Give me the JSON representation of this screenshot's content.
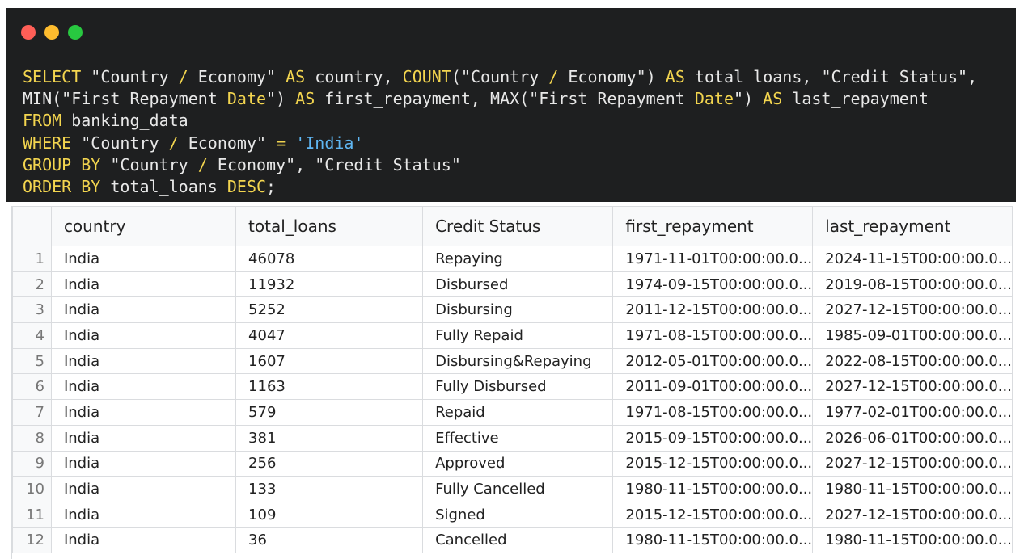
{
  "window": {
    "buttons": [
      "close",
      "minimize",
      "maximize"
    ],
    "colors": {
      "close": "#ff5f57",
      "minimize": "#febc2e",
      "maximize": "#28c840"
    }
  },
  "sql": {
    "lines": [
      [
        [
          "kw",
          "SELECT"
        ],
        [
          "t",
          " \"Country "
        ],
        [
          "op",
          "/"
        ],
        [
          "t",
          " Economy\" "
        ],
        [
          "kw",
          "AS"
        ],
        [
          "t",
          " country, "
        ],
        [
          "kw",
          "COUNT"
        ],
        [
          "t",
          "(\"Country "
        ],
        [
          "op",
          "/"
        ],
        [
          "t",
          " Economy\") "
        ],
        [
          "kw",
          "AS"
        ],
        [
          "t",
          " total_loans, \"Credit Status\","
        ]
      ],
      [
        [
          "t",
          "MIN(\"First Repayment "
        ],
        [
          "kw",
          "Date"
        ],
        [
          "t",
          "\") "
        ],
        [
          "kw",
          "AS"
        ],
        [
          "t",
          " first_repayment, MAX(\"First Repayment "
        ],
        [
          "kw",
          "Date"
        ],
        [
          "t",
          "\") "
        ],
        [
          "kw",
          "AS"
        ],
        [
          "t",
          " last_repayment"
        ]
      ],
      [
        [
          "kw",
          "FROM"
        ],
        [
          "t",
          " banking_data"
        ]
      ],
      [
        [
          "kw",
          "WHERE"
        ],
        [
          "t",
          " \"Country "
        ],
        [
          "op",
          "/"
        ],
        [
          "t",
          " Economy\" "
        ],
        [
          "op",
          "="
        ],
        [
          "t",
          " "
        ],
        [
          "str",
          "'India'"
        ]
      ],
      [
        [
          "kw",
          "GROUP BY"
        ],
        [
          "t",
          " \"Country "
        ],
        [
          "op",
          "/"
        ],
        [
          "t",
          " Economy\", \"Credit Status\""
        ]
      ],
      [
        [
          "kw",
          "ORDER BY"
        ],
        [
          "t",
          " total_loans "
        ],
        [
          "kw",
          "DESC"
        ],
        [
          "t",
          ";"
        ]
      ]
    ]
  },
  "results": {
    "columns": [
      "country",
      "total_loans",
      "Credit Status",
      "first_repayment",
      "last_repayment"
    ],
    "rows": [
      [
        "1",
        "India",
        "46078",
        "Repaying",
        "1971-11-01T00:00:00.0...",
        "2024-11-15T00:00:00.0..."
      ],
      [
        "2",
        "India",
        "11932",
        "Disbursed",
        "1974-09-15T00:00:00.0...",
        "2019-08-15T00:00:00.0..."
      ],
      [
        "3",
        "India",
        "5252",
        "Disbursing",
        "2011-12-15T00:00:00.0...",
        "2027-12-15T00:00:00.0..."
      ],
      [
        "4",
        "India",
        "4047",
        "Fully Repaid",
        "1971-08-15T00:00:00.0...",
        "1985-09-01T00:00:00.0..."
      ],
      [
        "5",
        "India",
        "1607",
        "Disbursing&Repaying",
        "2012-05-01T00:00:00.0...",
        "2022-08-15T00:00:00.0..."
      ],
      [
        "6",
        "India",
        "1163",
        "Fully Disbursed",
        "2011-09-01T00:00:00.0...",
        "2027-12-15T00:00:00.0..."
      ],
      [
        "7",
        "India",
        "579",
        "Repaid",
        "1971-08-15T00:00:00.0...",
        "1977-02-01T00:00:00.0..."
      ],
      [
        "8",
        "India",
        "381",
        "Effective",
        "2015-09-15T00:00:00.0...",
        "2026-06-01T00:00:00.0..."
      ],
      [
        "9",
        "India",
        "256",
        "Approved",
        "2015-12-15T00:00:00.0...",
        "2027-12-15T00:00:00.0..."
      ],
      [
        "10",
        "India",
        "133",
        "Fully Cancelled",
        "1980-11-15T00:00:00.0...",
        "1980-11-15T00:00:00.0..."
      ],
      [
        "11",
        "India",
        "109",
        "Signed",
        "2015-12-15T00:00:00.0...",
        "2027-12-15T00:00:00.0..."
      ],
      [
        "12",
        "India",
        "36",
        "Cancelled",
        "1980-11-15T00:00:00.0...",
        "1980-11-15T00:00:00.0..."
      ]
    ]
  }
}
